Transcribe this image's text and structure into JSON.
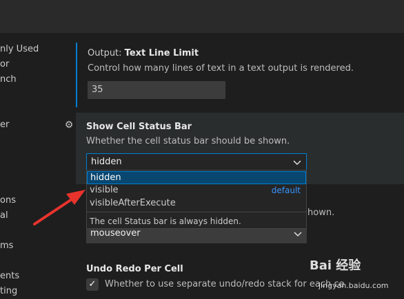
{
  "sidebar": {
    "items": [
      {
        "label": "nly Used"
      },
      {
        "label": "or"
      },
      {
        "label": "nch"
      },
      {
        "label": "er"
      },
      {
        "label": "ons"
      },
      {
        "label": "al"
      },
      {
        "label": "ms"
      },
      {
        "label": "ents"
      },
      {
        "label": "ting"
      }
    ]
  },
  "settings": {
    "output_text_line_limit": {
      "category": "Output: ",
      "key": "Text Line Limit",
      "description": "Control how many lines of text in a text output is rendered.",
      "value": "35"
    },
    "show_cell_status_bar": {
      "title": "Show Cell Status Bar",
      "description": "Whether the cell status bar should be shown.",
      "selected": "hidden",
      "options": [
        {
          "label": "hidden",
          "badge": ""
        },
        {
          "label": "visible",
          "badge": "default"
        },
        {
          "label": "visibleAfterExecute",
          "badge": ""
        }
      ],
      "option_description": "The cell Status bar is always hidden."
    },
    "partial_setting": {
      "description_tail": "hown.",
      "value": "mouseover"
    },
    "undo_redo_per_cell": {
      "title": "Undo Redo Per Cell",
      "description": "Whether to use separate undo/redo stack for each ce",
      "checked": "✓"
    }
  },
  "watermark": {
    "brand": "Bai  经验",
    "url": "jingyan.baidu.com"
  },
  "colors": {
    "accent": "#007fd4",
    "link": "#3794ff",
    "annotation_arrow": "#e8332d"
  },
  "icons": {
    "gear": "⚙"
  }
}
